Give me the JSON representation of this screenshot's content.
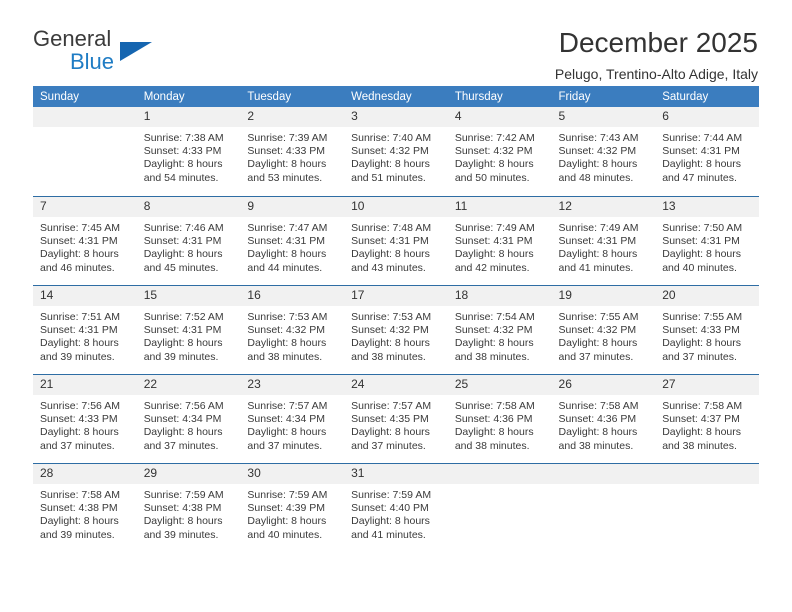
{
  "brand": {
    "name_top": "General",
    "name_bottom": "Blue",
    "accent_color": "#1565b0",
    "text_color": "#3b3b3b",
    "blue_text_color": "#1f7cc4"
  },
  "header": {
    "title": "December 2025",
    "subtitle": "Pelugo, Trentino-Alto Adige, Italy"
  },
  "theme": {
    "header_row_bg": "#3b7dbf",
    "daynum_bg": "#f1f1f1",
    "row_rule": "#2e6da4"
  },
  "weekday_headers": [
    "Sunday",
    "Monday",
    "Tuesday",
    "Wednesday",
    "Thursday",
    "Friday",
    "Saturday"
  ],
  "weeks": [
    [
      {
        "day": "",
        "sunrise": "",
        "sunset": "",
        "daylight1": "",
        "daylight2": "",
        "blank": true
      },
      {
        "day": "1",
        "sunrise": "Sunrise: 7:38 AM",
        "sunset": "Sunset: 4:33 PM",
        "daylight1": "Daylight: 8 hours",
        "daylight2": "and 54 minutes.",
        "blank": false
      },
      {
        "day": "2",
        "sunrise": "Sunrise: 7:39 AM",
        "sunset": "Sunset: 4:33 PM",
        "daylight1": "Daylight: 8 hours",
        "daylight2": "and 53 minutes.",
        "blank": false
      },
      {
        "day": "3",
        "sunrise": "Sunrise: 7:40 AM",
        "sunset": "Sunset: 4:32 PM",
        "daylight1": "Daylight: 8 hours",
        "daylight2": "and 51 minutes.",
        "blank": false
      },
      {
        "day": "4",
        "sunrise": "Sunrise: 7:42 AM",
        "sunset": "Sunset: 4:32 PM",
        "daylight1": "Daylight: 8 hours",
        "daylight2": "and 50 minutes.",
        "blank": false
      },
      {
        "day": "5",
        "sunrise": "Sunrise: 7:43 AM",
        "sunset": "Sunset: 4:32 PM",
        "daylight1": "Daylight: 8 hours",
        "daylight2": "and 48 minutes.",
        "blank": false
      },
      {
        "day": "6",
        "sunrise": "Sunrise: 7:44 AM",
        "sunset": "Sunset: 4:31 PM",
        "daylight1": "Daylight: 8 hours",
        "daylight2": "and 47 minutes.",
        "blank": false
      }
    ],
    [
      {
        "day": "7",
        "sunrise": "Sunrise: 7:45 AM",
        "sunset": "Sunset: 4:31 PM",
        "daylight1": "Daylight: 8 hours",
        "daylight2": "and 46 minutes.",
        "blank": false
      },
      {
        "day": "8",
        "sunrise": "Sunrise: 7:46 AM",
        "sunset": "Sunset: 4:31 PM",
        "daylight1": "Daylight: 8 hours",
        "daylight2": "and 45 minutes.",
        "blank": false
      },
      {
        "day": "9",
        "sunrise": "Sunrise: 7:47 AM",
        "sunset": "Sunset: 4:31 PM",
        "daylight1": "Daylight: 8 hours",
        "daylight2": "and 44 minutes.",
        "blank": false
      },
      {
        "day": "10",
        "sunrise": "Sunrise: 7:48 AM",
        "sunset": "Sunset: 4:31 PM",
        "daylight1": "Daylight: 8 hours",
        "daylight2": "and 43 minutes.",
        "blank": false
      },
      {
        "day": "11",
        "sunrise": "Sunrise: 7:49 AM",
        "sunset": "Sunset: 4:31 PM",
        "daylight1": "Daylight: 8 hours",
        "daylight2": "and 42 minutes.",
        "blank": false
      },
      {
        "day": "12",
        "sunrise": "Sunrise: 7:49 AM",
        "sunset": "Sunset: 4:31 PM",
        "daylight1": "Daylight: 8 hours",
        "daylight2": "and 41 minutes.",
        "blank": false
      },
      {
        "day": "13",
        "sunrise": "Sunrise: 7:50 AM",
        "sunset": "Sunset: 4:31 PM",
        "daylight1": "Daylight: 8 hours",
        "daylight2": "and 40 minutes.",
        "blank": false
      }
    ],
    [
      {
        "day": "14",
        "sunrise": "Sunrise: 7:51 AM",
        "sunset": "Sunset: 4:31 PM",
        "daylight1": "Daylight: 8 hours",
        "daylight2": "and 39 minutes.",
        "blank": false
      },
      {
        "day": "15",
        "sunrise": "Sunrise: 7:52 AM",
        "sunset": "Sunset: 4:31 PM",
        "daylight1": "Daylight: 8 hours",
        "daylight2": "and 39 minutes.",
        "blank": false
      },
      {
        "day": "16",
        "sunrise": "Sunrise: 7:53 AM",
        "sunset": "Sunset: 4:32 PM",
        "daylight1": "Daylight: 8 hours",
        "daylight2": "and 38 minutes.",
        "blank": false
      },
      {
        "day": "17",
        "sunrise": "Sunrise: 7:53 AM",
        "sunset": "Sunset: 4:32 PM",
        "daylight1": "Daylight: 8 hours",
        "daylight2": "and 38 minutes.",
        "blank": false
      },
      {
        "day": "18",
        "sunrise": "Sunrise: 7:54 AM",
        "sunset": "Sunset: 4:32 PM",
        "daylight1": "Daylight: 8 hours",
        "daylight2": "and 38 minutes.",
        "blank": false
      },
      {
        "day": "19",
        "sunrise": "Sunrise: 7:55 AM",
        "sunset": "Sunset: 4:32 PM",
        "daylight1": "Daylight: 8 hours",
        "daylight2": "and 37 minutes.",
        "blank": false
      },
      {
        "day": "20",
        "sunrise": "Sunrise: 7:55 AM",
        "sunset": "Sunset: 4:33 PM",
        "daylight1": "Daylight: 8 hours",
        "daylight2": "and 37 minutes.",
        "blank": false
      }
    ],
    [
      {
        "day": "21",
        "sunrise": "Sunrise: 7:56 AM",
        "sunset": "Sunset: 4:33 PM",
        "daylight1": "Daylight: 8 hours",
        "daylight2": "and 37 minutes.",
        "blank": false
      },
      {
        "day": "22",
        "sunrise": "Sunrise: 7:56 AM",
        "sunset": "Sunset: 4:34 PM",
        "daylight1": "Daylight: 8 hours",
        "daylight2": "and 37 minutes.",
        "blank": false
      },
      {
        "day": "23",
        "sunrise": "Sunrise: 7:57 AM",
        "sunset": "Sunset: 4:34 PM",
        "daylight1": "Daylight: 8 hours",
        "daylight2": "and 37 minutes.",
        "blank": false
      },
      {
        "day": "24",
        "sunrise": "Sunrise: 7:57 AM",
        "sunset": "Sunset: 4:35 PM",
        "daylight1": "Daylight: 8 hours",
        "daylight2": "and 37 minutes.",
        "blank": false
      },
      {
        "day": "25",
        "sunrise": "Sunrise: 7:58 AM",
        "sunset": "Sunset: 4:36 PM",
        "daylight1": "Daylight: 8 hours",
        "daylight2": "and 38 minutes.",
        "blank": false
      },
      {
        "day": "26",
        "sunrise": "Sunrise: 7:58 AM",
        "sunset": "Sunset: 4:36 PM",
        "daylight1": "Daylight: 8 hours",
        "daylight2": "and 38 minutes.",
        "blank": false
      },
      {
        "day": "27",
        "sunrise": "Sunrise: 7:58 AM",
        "sunset": "Sunset: 4:37 PM",
        "daylight1": "Daylight: 8 hours",
        "daylight2": "and 38 minutes.",
        "blank": false
      }
    ],
    [
      {
        "day": "28",
        "sunrise": "Sunrise: 7:58 AM",
        "sunset": "Sunset: 4:38 PM",
        "daylight1": "Daylight: 8 hours",
        "daylight2": "and 39 minutes.",
        "blank": false
      },
      {
        "day": "29",
        "sunrise": "Sunrise: 7:59 AM",
        "sunset": "Sunset: 4:38 PM",
        "daylight1": "Daylight: 8 hours",
        "daylight2": "and 39 minutes.",
        "blank": false
      },
      {
        "day": "30",
        "sunrise": "Sunrise: 7:59 AM",
        "sunset": "Sunset: 4:39 PM",
        "daylight1": "Daylight: 8 hours",
        "daylight2": "and 40 minutes.",
        "blank": false
      },
      {
        "day": "31",
        "sunrise": "Sunrise: 7:59 AM",
        "sunset": "Sunset: 4:40 PM",
        "daylight1": "Daylight: 8 hours",
        "daylight2": "and 41 minutes.",
        "blank": false
      },
      {
        "day": "",
        "sunrise": "",
        "sunset": "",
        "daylight1": "",
        "daylight2": "",
        "blank": true
      },
      {
        "day": "",
        "sunrise": "",
        "sunset": "",
        "daylight1": "",
        "daylight2": "",
        "blank": true
      },
      {
        "day": "",
        "sunrise": "",
        "sunset": "",
        "daylight1": "",
        "daylight2": "",
        "blank": true
      }
    ]
  ]
}
